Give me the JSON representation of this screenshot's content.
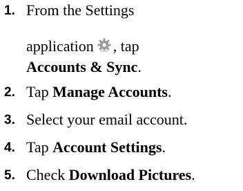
{
  "steps": [
    {
      "number": "1.",
      "line1": "From the Settings",
      "line2_before": "application",
      "line2_after": ", tap",
      "line3_bold": "Accounts & Sync",
      "line3_after": "."
    },
    {
      "number": "2.",
      "before": "Tap ",
      "bold": "Manage Accounts",
      "after": "."
    },
    {
      "number": "3.",
      "text": "Select your email account."
    },
    {
      "number": "4.",
      "before": "Tap ",
      "bold": "Account Settings",
      "after": "."
    },
    {
      "number": "5.",
      "before": "Check ",
      "bold": "Download Pictures",
      "after": "."
    }
  ],
  "icons": {
    "settings": "gear-icon"
  },
  "colors": {
    "text": "#000000",
    "icon": "#9a9a9a"
  }
}
